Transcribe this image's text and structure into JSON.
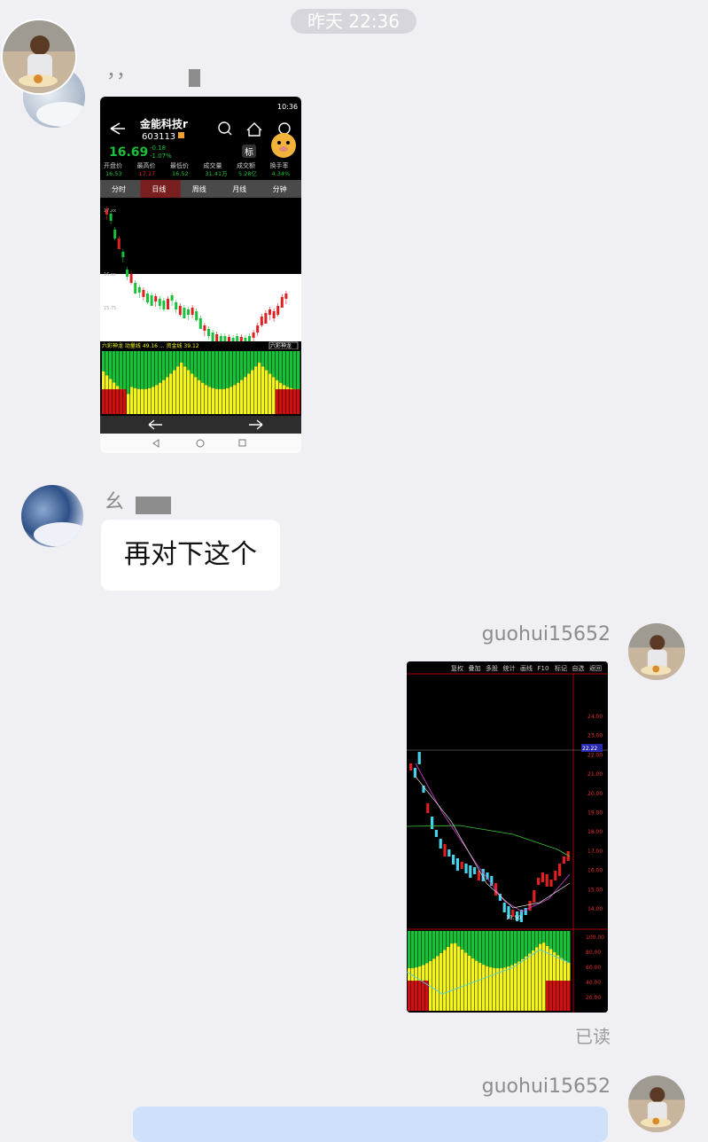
{
  "chat": {
    "timestamp": "昨天 22:36",
    "read_status": "已读",
    "me_name": "guohui15652",
    "me_name_2": "guohui15652",
    "other_name_1": "，，",
    "other_name_2": "幺",
    "message_text": "再对下这个"
  },
  "phone_screenshot": {
    "status_time": "10:36",
    "stock_name": "金能科技r",
    "stock_code": "603113",
    "price": "16.69",
    "change": "-0.18",
    "change_pct": "-1.07%",
    "tag_label": "标",
    "stats": [
      {
        "label": "开盘价",
        "value": "16.53"
      },
      {
        "label": "最高价",
        "value": "17.17"
      },
      {
        "label": "最低价",
        "value": "16.52"
      },
      {
        "label": "成交量",
        "value": "31.41万"
      },
      {
        "label": "成交额",
        "value": "5.28亿"
      },
      {
        "label": "换手率",
        "value": "4.34%"
      }
    ],
    "tabs": [
      "分时",
      "日线",
      "周线",
      "月线",
      "分钟"
    ],
    "active_tab": "日线",
    "indicator_bar": "六彩神龙 动量线 49.16 ... 资金线 39.12",
    "indicator_right": "六彩神龙",
    "colors": {
      "up": "#e02020",
      "down": "#19c13b",
      "bg": "#000000",
      "yellow": "#f5f51e"
    }
  },
  "pc_screenshot": {
    "toolbar": [
      "复权",
      "叠加",
      "多股",
      "统计",
      "画线",
      "F10",
      "标记",
      "自选",
      "返回"
    ],
    "price_ticks": [
      "24.00",
      "23.00",
      "22.00",
      "21.00",
      "20.00",
      "19.00",
      "18.00",
      "17.00",
      "16.00",
      "15.00",
      "14.00"
    ],
    "current_price_label": "22.22",
    "low_label": "13.50",
    "indicator_ticks": [
      "100.00",
      "80.00",
      "60.00",
      "40.00",
      "20.00"
    ]
  }
}
